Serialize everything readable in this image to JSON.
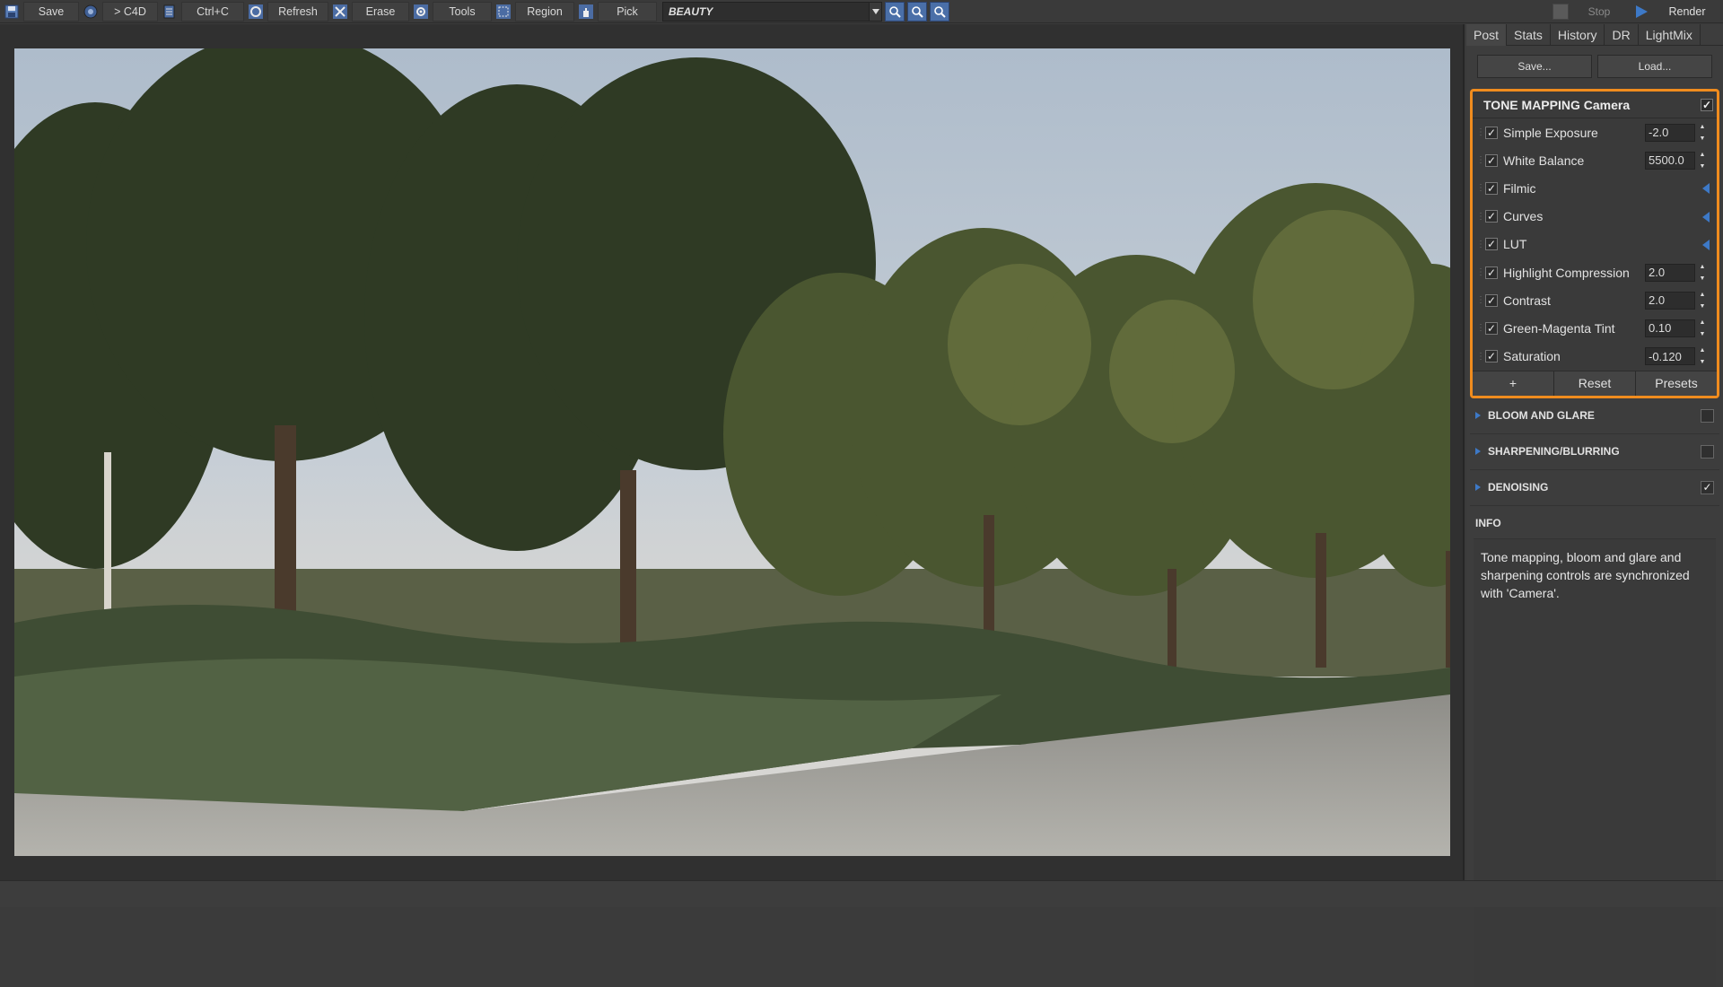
{
  "toolbar": {
    "save": "Save",
    "c4d": "> C4D",
    "copy": "Ctrl+C",
    "refresh": "Refresh",
    "erase": "Erase",
    "tools": "Tools",
    "region": "Region",
    "pick": "Pick",
    "pass_select": "BEAUTY",
    "stop": "Stop",
    "render": "Render"
  },
  "panel": {
    "tabs": [
      "Post",
      "Stats",
      "History",
      "DR",
      "LightMix"
    ],
    "save_label": "Save...",
    "load_label": "Load...",
    "tone_mapping": {
      "title": "TONE MAPPING Camera",
      "enabled": true,
      "params": [
        {
          "name": "Simple Exposure",
          "value": "-2.0",
          "checked": true
        },
        {
          "name": "White Balance",
          "value": "5500.0",
          "checked": true
        },
        {
          "name": "Filmic",
          "value": null,
          "checked": true
        },
        {
          "name": "Curves",
          "value": null,
          "checked": true
        },
        {
          "name": "LUT",
          "value": null,
          "checked": true
        },
        {
          "name": "Highlight Compression",
          "value": "2.0",
          "checked": true
        },
        {
          "name": "Contrast",
          "value": "2.0",
          "checked": true
        },
        {
          "name": "Green-Magenta Tint",
          "value": "0.10",
          "checked": true
        },
        {
          "name": "Saturation",
          "value": "-0.120",
          "checked": true
        }
      ],
      "add_label": "+",
      "reset_label": "Reset",
      "presets_label": "Presets"
    },
    "sections": [
      {
        "title": "BLOOM AND GLARE",
        "checked": false
      },
      {
        "title": "SHARPENING/BLURRING",
        "checked": false
      },
      {
        "title": "DENOISING",
        "checked": true
      }
    ],
    "info_title": "INFO",
    "info_text": "Tone mapping, bloom and glare and sharpening controls are synchronized with 'Camera'."
  },
  "colors": {
    "accent_orange": "#f08c1e",
    "accent_blue": "#3d79c7"
  }
}
